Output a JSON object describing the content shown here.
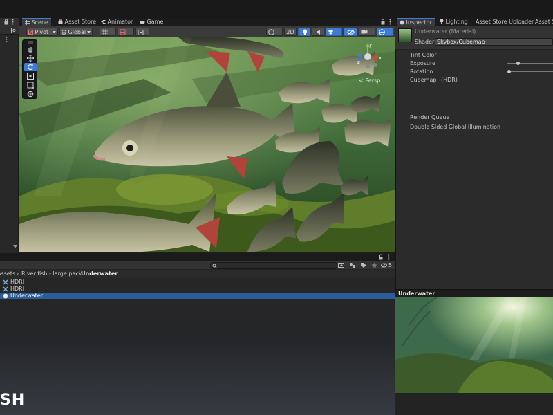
{
  "scene_tabs": [
    {
      "label": "Scene",
      "icon": "scene-grid-icon"
    },
    {
      "label": "Asset Store",
      "icon": "asset-store-bag-icon"
    },
    {
      "label": "Animator",
      "icon": "animator-icon"
    },
    {
      "label": "Game",
      "icon": "game-controller-icon"
    }
  ],
  "scene_toolbar": {
    "pivot_label": "Pivot",
    "global_label": "Global",
    "two_d_label": "2D"
  },
  "viewport": {
    "persp_label": "< Persp",
    "gizmo_axes": {
      "x": "x",
      "y": "y",
      "z": "z"
    }
  },
  "project": {
    "filter_count": "5",
    "breadcrumb": [
      "Assets",
      "River fish - large pack",
      "Underwater"
    ],
    "items": [
      {
        "label": "HDRI",
        "icon": "hdri-texture-icon",
        "selected": false
      },
      {
        "label": "HDRI",
        "icon": "hdri-texture-icon",
        "selected": false
      },
      {
        "label": "Underwater",
        "icon": "material-sphere-icon",
        "selected": true
      }
    ],
    "watermark": "SH"
  },
  "inspector": {
    "tabs": [
      {
        "label": "Inspector",
        "icon": "inspector-info-icon"
      },
      {
        "label": "Lighting",
        "icon": "lightbulb-icon"
      },
      {
        "label": "Asset Store Uploader",
        "icon": ""
      },
      {
        "label": "Asset S",
        "icon": ""
      }
    ],
    "material_title": "Underwater (Material)",
    "shader_label": "Shader",
    "shader_value": "Skybox/Cubemap",
    "props": {
      "tint_color": "Tint Color",
      "exposure": "Exposure",
      "rotation": "Rotation",
      "cubemap": "Cubemap",
      "cubemap_hint": "(HDR)",
      "render_queue": "Render Queue",
      "dsgi": "Double Sided Global Illumination"
    },
    "exposure_level": 0.22,
    "rotation_level": 0.02
  },
  "preview": {
    "title": "Underwater"
  },
  "colors": {
    "accent": "#3d7bd6",
    "selection": "#2c5d9b",
    "panel": "#2b2b2b"
  }
}
